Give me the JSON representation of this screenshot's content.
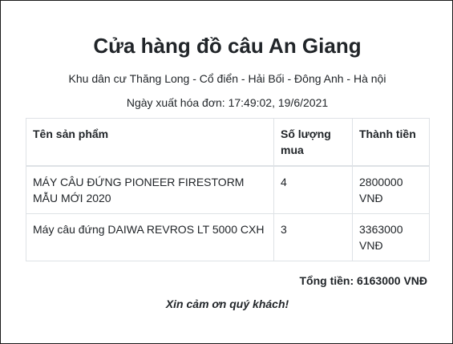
{
  "invoice": {
    "store_name": "Cửa hàng đồ câu An Giang",
    "address": "Khu dân cư Thăng Long - Cổ điển - Hải Bối - Đông Anh - Hà nội",
    "date_label": "Ngày xuất hóa đơn: ",
    "date_value": "17:49:02, 19/6/2021",
    "table": {
      "headers": [
        "Tên sản phẩm",
        "Số lượng mua",
        "Thành tiền"
      ],
      "rows": [
        {
          "product": "MÁY CÂU ĐỨNG PIONEER FIRESTORM MẪU MỚI 2020",
          "quantity": "4",
          "amount": "2800000 VNĐ"
        },
        {
          "product": "Máy câu đứng DAIWA REVROS LT 5000 CXH",
          "quantity": "3",
          "amount": "3363000 VNĐ"
        }
      ]
    },
    "total_label": "Tổng tiền: ",
    "total_value": "6163000 VNĐ",
    "thanks": "Xin cảm ơn quý khách!"
  }
}
